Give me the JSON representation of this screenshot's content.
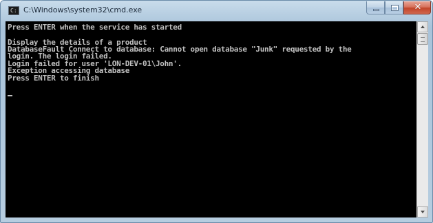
{
  "window": {
    "title": "C:\\Windows\\system32\\cmd.exe",
    "icon": "console-icon",
    "controls": {
      "minimize_icon": "minimize-icon",
      "maximize_icon": "maximize-icon",
      "close_icon": "close-icon",
      "close_glyph": "✕"
    },
    "colors": {
      "console_bg": "#000000",
      "console_text": "#c0c0c0",
      "close_button": "#c7462c"
    }
  },
  "console": {
    "lines": [
      "Press ENTER when the service has started",
      "",
      "Display the details of a product",
      "DatabaseFault Connect to database: Cannot open database \"Junk\" requested by the",
      "login. The login failed.",
      "Login failed for user 'LON-DEV-01\\John'.",
      "Exception accessing database",
      "Press ENTER to finish"
    ],
    "cursor_icon": "text-cursor"
  }
}
